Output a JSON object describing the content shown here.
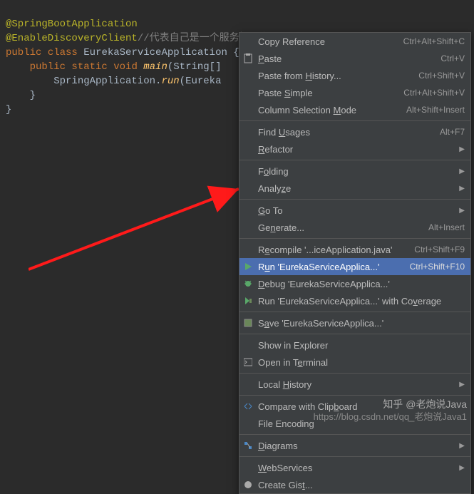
{
  "code": {
    "line1_annotation": "@SpringBootApplication",
    "line2_annotation": "@EnableDiscoveryClient",
    "line2_comment": "//代表自己是一个服务提供方",
    "line3_public": "public ",
    "line3_class": "class ",
    "line3_name": "EurekaServiceApplication ",
    "line3_brace": "{",
    "line4_indent": "    ",
    "line4_public": "public ",
    "line4_static": "static ",
    "line4_void": "void ",
    "line4_main": "main",
    "line4_params": "(String[]",
    "line5_indent": "        ",
    "line5_class": "SpringApplication.",
    "line5_run": "run",
    "line5_params": "(Eureka",
    "line6_indent": "    ",
    "line6_brace": "}",
    "line7_brace": "}"
  },
  "menu": {
    "copyRef": "Copy Reference",
    "copyRef_sc": "Ctrl+Alt+Shift+C",
    "paste": "Paste",
    "paste_sc": "Ctrl+V",
    "pasteHistory": "Paste from History...",
    "pasteHistory_sc": "Ctrl+Shift+V",
    "pasteSimple": "Paste Simple",
    "pasteSimple_sc": "Ctrl+Alt+Shift+V",
    "columnSel": "Column Selection Mode",
    "columnSel_sc": "Alt+Shift+Insert",
    "findUsages": "Find Usages",
    "findUsages_sc": "Alt+F7",
    "refactor": "Refactor",
    "folding": "Folding",
    "analyze": "Analyze",
    "goto": "Go To",
    "generate": "Generate...",
    "generate_sc": "Alt+Insert",
    "recompile": "Recompile '...iceApplication.java'",
    "recompile_sc": "Ctrl+Shift+F9",
    "run": "Run 'EurekaServiceApplica...'",
    "run_sc": "Ctrl+Shift+F10",
    "debug": "Debug 'EurekaServiceApplica...'",
    "runCov": "Run 'EurekaServiceApplica...' with Coverage",
    "save": "Save 'EurekaServiceApplica...'",
    "showExpl": "Show in Explorer",
    "openTerm": "Open in Terminal",
    "localHist": "Local History",
    "compare": "Compare with Clipboard",
    "fileEnc": "File Encoding",
    "diagrams": "Diagrams",
    "webServ": "WebServices",
    "createGist": "Create Gist..."
  },
  "watermark": {
    "top": "知乎 @老炮说Java",
    "bottom": "https://blog.csdn.net/qq_老炮说Java1"
  }
}
